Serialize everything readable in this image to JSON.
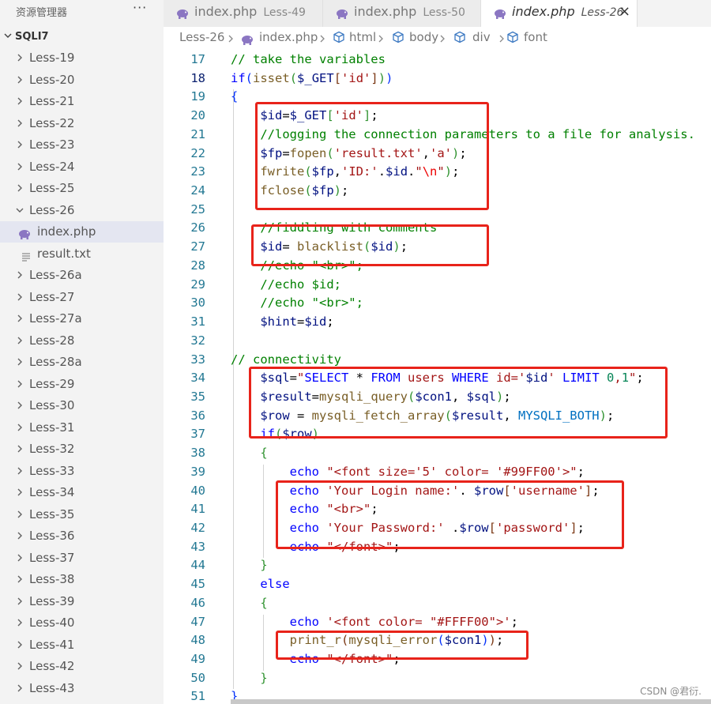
{
  "sidebar": {
    "title": "资源管理器",
    "more": "···",
    "root": "SQLI7",
    "items": [
      {
        "label": "Less-19",
        "kind": "folder",
        "expanded": false
      },
      {
        "label": "Less-20",
        "kind": "folder",
        "expanded": false
      },
      {
        "label": "Less-21",
        "kind": "folder",
        "expanded": false
      },
      {
        "label": "Less-22",
        "kind": "folder",
        "expanded": false
      },
      {
        "label": "Less-23",
        "kind": "folder",
        "expanded": false
      },
      {
        "label": "Less-24",
        "kind": "folder",
        "expanded": false
      },
      {
        "label": "Less-25",
        "kind": "folder",
        "expanded": false
      },
      {
        "label": "Less-26",
        "kind": "folder",
        "expanded": true
      },
      {
        "label": "index.php",
        "kind": "php-file",
        "active": true
      },
      {
        "label": "result.txt",
        "kind": "txt-file"
      },
      {
        "label": "Less-26a",
        "kind": "folder",
        "expanded": false
      },
      {
        "label": "Less-27",
        "kind": "folder",
        "expanded": false
      },
      {
        "label": "Less-27a",
        "kind": "folder",
        "expanded": false
      },
      {
        "label": "Less-28",
        "kind": "folder",
        "expanded": false
      },
      {
        "label": "Less-28a",
        "kind": "folder",
        "expanded": false
      },
      {
        "label": "Less-29",
        "kind": "folder",
        "expanded": false
      },
      {
        "label": "Less-30",
        "kind": "folder",
        "expanded": false
      },
      {
        "label": "Less-31",
        "kind": "folder",
        "expanded": false
      },
      {
        "label": "Less-32",
        "kind": "folder",
        "expanded": false
      },
      {
        "label": "Less-33",
        "kind": "folder",
        "expanded": false
      },
      {
        "label": "Less-34",
        "kind": "folder",
        "expanded": false
      },
      {
        "label": "Less-35",
        "kind": "folder",
        "expanded": false
      },
      {
        "label": "Less-36",
        "kind": "folder",
        "expanded": false
      },
      {
        "label": "Less-37",
        "kind": "folder",
        "expanded": false
      },
      {
        "label": "Less-38",
        "kind": "folder",
        "expanded": false
      },
      {
        "label": "Less-39",
        "kind": "folder",
        "expanded": false
      },
      {
        "label": "Less-40",
        "kind": "folder",
        "expanded": false
      },
      {
        "label": "Less-41",
        "kind": "folder",
        "expanded": false
      },
      {
        "label": "Less-42",
        "kind": "folder",
        "expanded": false
      },
      {
        "label": "Less-43",
        "kind": "folder",
        "expanded": false
      }
    ]
  },
  "tabs": [
    {
      "name": "index.php",
      "desc": "Less-49",
      "active": false
    },
    {
      "name": "index.php",
      "desc": "Less-50",
      "active": false
    },
    {
      "name": "index.php",
      "desc": "Less-26",
      "active": true,
      "close": "×"
    }
  ],
  "breadcrumb": {
    "folder": "Less-26",
    "file": "index.php",
    "symbols": [
      "html",
      "body",
      "div",
      "font"
    ]
  },
  "editor": {
    "current_line": 18,
    "lines": [
      {
        "n": 17,
        "tokens": [
          [
            "cm",
            "// take the variables"
          ]
        ]
      },
      {
        "n": 18,
        "tokens": [
          [
            "kw",
            "if"
          ],
          [
            "br1",
            "("
          ],
          [
            "fn",
            "isset"
          ],
          [
            "br2",
            "("
          ],
          [
            "var",
            "$_GET"
          ],
          [
            "br3",
            "["
          ],
          [
            "str",
            "'id'"
          ],
          [
            "br3",
            "]"
          ],
          [
            "br2",
            ")"
          ],
          [
            "br1",
            ")"
          ]
        ]
      },
      {
        "n": 19,
        "tokens": [
          [
            "br1",
            "{"
          ]
        ]
      },
      {
        "n": 20,
        "tokens": [
          [
            "plain",
            "    "
          ],
          [
            "var",
            "$id"
          ],
          [
            "plain",
            "="
          ],
          [
            "var",
            "$_GET"
          ],
          [
            "br2",
            "["
          ],
          [
            "str",
            "'id'"
          ],
          [
            "br2",
            "]"
          ],
          [
            "plain",
            ";"
          ]
        ]
      },
      {
        "n": 21,
        "tokens": [
          [
            "plain",
            "    "
          ],
          [
            "cm",
            "//logging the connection parameters to a file for analysis."
          ]
        ]
      },
      {
        "n": 22,
        "tokens": [
          [
            "plain",
            "    "
          ],
          [
            "var",
            "$fp"
          ],
          [
            "plain",
            "="
          ],
          [
            "fn",
            "fopen"
          ],
          [
            "br2",
            "("
          ],
          [
            "str",
            "'result.txt'"
          ],
          [
            "plain",
            ","
          ],
          [
            "str",
            "'a'"
          ],
          [
            "br2",
            ")"
          ],
          [
            "plain",
            ";"
          ]
        ]
      },
      {
        "n": 23,
        "tokens": [
          [
            "plain",
            "    "
          ],
          [
            "fn",
            "fwrite"
          ],
          [
            "br2",
            "("
          ],
          [
            "var",
            "$fp"
          ],
          [
            "plain",
            ","
          ],
          [
            "str",
            "'ID:'"
          ],
          [
            "plain",
            "."
          ],
          [
            "var",
            "$id"
          ],
          [
            "plain",
            "."
          ],
          [
            "str",
            "\""
          ],
          [
            "esc",
            "\\n"
          ],
          [
            "str",
            "\""
          ],
          [
            "br2",
            ")"
          ],
          [
            "plain",
            ";"
          ]
        ]
      },
      {
        "n": 24,
        "tokens": [
          [
            "plain",
            "    "
          ],
          [
            "fn",
            "fclose"
          ],
          [
            "br2",
            "("
          ],
          [
            "var",
            "$fp"
          ],
          [
            "br2",
            ")"
          ],
          [
            "plain",
            ";"
          ]
        ]
      },
      {
        "n": 25,
        "tokens": []
      },
      {
        "n": 26,
        "tokens": [
          [
            "plain",
            "    "
          ],
          [
            "cm",
            "//fiddling with comments"
          ]
        ]
      },
      {
        "n": 27,
        "tokens": [
          [
            "plain",
            "    "
          ],
          [
            "var",
            "$id"
          ],
          [
            "plain",
            "= "
          ],
          [
            "fn",
            "blacklist"
          ],
          [
            "br2",
            "("
          ],
          [
            "var",
            "$id"
          ],
          [
            "br2",
            ")"
          ],
          [
            "plain",
            ";"
          ]
        ]
      },
      {
        "n": 28,
        "tokens": [
          [
            "plain",
            "    "
          ],
          [
            "cm",
            "//echo \"<br>\";"
          ]
        ]
      },
      {
        "n": 29,
        "tokens": [
          [
            "plain",
            "    "
          ],
          [
            "cm",
            "//echo $id;"
          ]
        ]
      },
      {
        "n": 30,
        "tokens": [
          [
            "plain",
            "    "
          ],
          [
            "cm",
            "//echo \"<br>\";"
          ]
        ]
      },
      {
        "n": 31,
        "tokens": [
          [
            "plain",
            "    "
          ],
          [
            "var",
            "$hint"
          ],
          [
            "plain",
            "="
          ],
          [
            "var",
            "$id"
          ],
          [
            "plain",
            ";"
          ]
        ]
      },
      {
        "n": 32,
        "tokens": []
      },
      {
        "n": 33,
        "tokens": [
          [
            "cm",
            "// connectivity"
          ]
        ]
      },
      {
        "n": 34,
        "tokens": [
          [
            "plain",
            "    "
          ],
          [
            "var",
            "$sql"
          ],
          [
            "plain",
            "="
          ],
          [
            "str",
            "\""
          ],
          [
            "kw",
            "SELECT"
          ],
          [
            "plain",
            " * "
          ],
          [
            "kw",
            "FROM"
          ],
          [
            "str",
            " users "
          ],
          [
            "kw",
            "WHERE"
          ],
          [
            "str",
            " id='"
          ],
          [
            "var",
            "$id"
          ],
          [
            "str",
            "' "
          ],
          [
            "kw",
            "LIMIT"
          ],
          [
            "num",
            " 0"
          ],
          [
            "str",
            ","
          ],
          [
            "num",
            "1"
          ],
          [
            "str",
            "\""
          ],
          [
            "plain",
            ";"
          ]
        ]
      },
      {
        "n": 35,
        "tokens": [
          [
            "plain",
            "    "
          ],
          [
            "var",
            "$result"
          ],
          [
            "plain",
            "="
          ],
          [
            "fn",
            "mysqli_query"
          ],
          [
            "br2",
            "("
          ],
          [
            "var",
            "$con1"
          ],
          [
            "plain",
            ", "
          ],
          [
            "var",
            "$sql"
          ],
          [
            "br2",
            ")"
          ],
          [
            "plain",
            ";"
          ]
        ]
      },
      {
        "n": 36,
        "tokens": [
          [
            "plain",
            "    "
          ],
          [
            "var",
            "$row"
          ],
          [
            "plain",
            " = "
          ],
          [
            "fn",
            "mysqli_fetch_array"
          ],
          [
            "br2",
            "("
          ],
          [
            "var",
            "$result"
          ],
          [
            "plain",
            ", "
          ],
          [
            "const",
            "MYSQLI_BOTH"
          ],
          [
            "br2",
            ")"
          ],
          [
            "plain",
            ";"
          ]
        ]
      },
      {
        "n": 37,
        "tokens": [
          [
            "plain",
            "    "
          ],
          [
            "kw",
            "if"
          ],
          [
            "br2",
            "("
          ],
          [
            "var",
            "$row"
          ],
          [
            "br2",
            ")"
          ]
        ]
      },
      {
        "n": 38,
        "tokens": [
          [
            "plain",
            "    "
          ],
          [
            "br2",
            "{"
          ]
        ]
      },
      {
        "n": 39,
        "tokens": [
          [
            "plain",
            "        "
          ],
          [
            "kw",
            "echo"
          ],
          [
            "plain",
            " "
          ],
          [
            "str",
            "\"<font size='5' color= '#99FF00'>\""
          ],
          [
            "plain",
            ";"
          ]
        ]
      },
      {
        "n": 40,
        "tokens": [
          [
            "plain",
            "        "
          ],
          [
            "kw",
            "echo"
          ],
          [
            "plain",
            " "
          ],
          [
            "str",
            "'Your Login name:'"
          ],
          [
            "plain",
            ". "
          ],
          [
            "var",
            "$row"
          ],
          [
            "br3",
            "["
          ],
          [
            "str",
            "'username'"
          ],
          [
            "br3",
            "]"
          ],
          [
            "plain",
            ";"
          ]
        ]
      },
      {
        "n": 41,
        "tokens": [
          [
            "plain",
            "        "
          ],
          [
            "kw",
            "echo"
          ],
          [
            "plain",
            " "
          ],
          [
            "str",
            "\"<br>\""
          ],
          [
            "plain",
            ";"
          ]
        ]
      },
      {
        "n": 42,
        "tokens": [
          [
            "plain",
            "        "
          ],
          [
            "kw",
            "echo"
          ],
          [
            "plain",
            " "
          ],
          [
            "str",
            "'Your Password:'"
          ],
          [
            "plain",
            " ."
          ],
          [
            "var",
            "$row"
          ],
          [
            "br3",
            "["
          ],
          [
            "str",
            "'password'"
          ],
          [
            "br3",
            "]"
          ],
          [
            "plain",
            ";"
          ]
        ]
      },
      {
        "n": 43,
        "tokens": [
          [
            "plain",
            "        "
          ],
          [
            "kw",
            "echo"
          ],
          [
            "plain",
            " "
          ],
          [
            "str",
            "\"</font>\""
          ],
          [
            "plain",
            ";"
          ]
        ]
      },
      {
        "n": 44,
        "tokens": [
          [
            "plain",
            "    "
          ],
          [
            "br2",
            "}"
          ]
        ]
      },
      {
        "n": 45,
        "tokens": [
          [
            "plain",
            "    "
          ],
          [
            "kw",
            "else"
          ]
        ]
      },
      {
        "n": 46,
        "tokens": [
          [
            "plain",
            "    "
          ],
          [
            "br2",
            "{"
          ]
        ]
      },
      {
        "n": 47,
        "tokens": [
          [
            "plain",
            "        "
          ],
          [
            "kw",
            "echo"
          ],
          [
            "plain",
            " "
          ],
          [
            "str",
            "'<font color= \"#FFFF00\">'"
          ],
          [
            "plain",
            ";"
          ]
        ]
      },
      {
        "n": 48,
        "tokens": [
          [
            "plain",
            "        "
          ],
          [
            "fn",
            "print_r"
          ],
          [
            "br3",
            "("
          ],
          [
            "fn",
            "mysqli_error"
          ],
          [
            "c3b",
            "("
          ],
          [
            "var",
            "$con1"
          ],
          [
            "c3b",
            ")"
          ],
          [
            "br3",
            ")"
          ],
          [
            "plain",
            ";"
          ]
        ]
      },
      {
        "n": 49,
        "tokens": [
          [
            "plain",
            "        "
          ],
          [
            "kw",
            "echo"
          ],
          [
            "plain",
            " "
          ],
          [
            "str",
            "\"</font>\""
          ],
          [
            "plain",
            ";"
          ]
        ]
      },
      {
        "n": 50,
        "tokens": [
          [
            "plain",
            "    "
          ],
          [
            "br2",
            "}"
          ]
        ]
      },
      {
        "n": 51,
        "tokens": [
          [
            "br1",
            "}"
          ]
        ]
      }
    ]
  },
  "annotation_color": "#e8231a",
  "watermark": "CSDN @君衍."
}
